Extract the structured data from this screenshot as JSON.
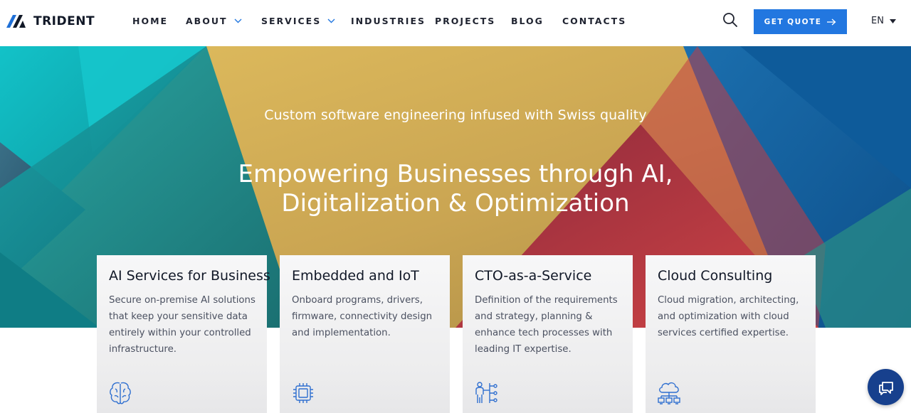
{
  "brand": {
    "name": "TRIDENT"
  },
  "nav": {
    "items": [
      {
        "label": "HOME"
      },
      {
        "label": "ABOUT"
      },
      {
        "label": "SERVICES"
      },
      {
        "label": "INDUSTRIES"
      },
      {
        "label": "PROJECTS"
      },
      {
        "label": "BLOG"
      },
      {
        "label": "CONTACTS"
      }
    ]
  },
  "header": {
    "quote_label": "GET QUOTE",
    "lang": "EN"
  },
  "hero": {
    "subtitle": "Custom software engineering infused with Swiss quality",
    "title_line1": "Empowering Businesses through AI,",
    "title_line2": "Digitalization & Optimization"
  },
  "cards": [
    {
      "title": "AI Services for Business",
      "text": "Secure on-premise AI solutions that keep your sensitive data entirely within your controlled infrastructure.",
      "icon": "brain-icon"
    },
    {
      "title": "Embedded and IoT",
      "text": "Onboard programs, drivers, firmware, connectivity design and implementation.",
      "icon": "chip-icon"
    },
    {
      "title": "CTO-as-a-Service",
      "text": "Definition of the requirements and strategy, planning & enhance tech processes with leading IT expertise.",
      "icon": "strategy-person-icon"
    },
    {
      "title": "Cloud Consulting",
      "text": "Cloud migration, architecting, and optimization with cloud services certified expertise.",
      "icon": "cloud-network-icon"
    }
  ],
  "colors": {
    "accent": "#2277e0",
    "chat": "#17408d",
    "teal": "#1bb3ba",
    "gold": "#d8b25a",
    "red": "#b8323b",
    "blue": "#1565a8"
  }
}
